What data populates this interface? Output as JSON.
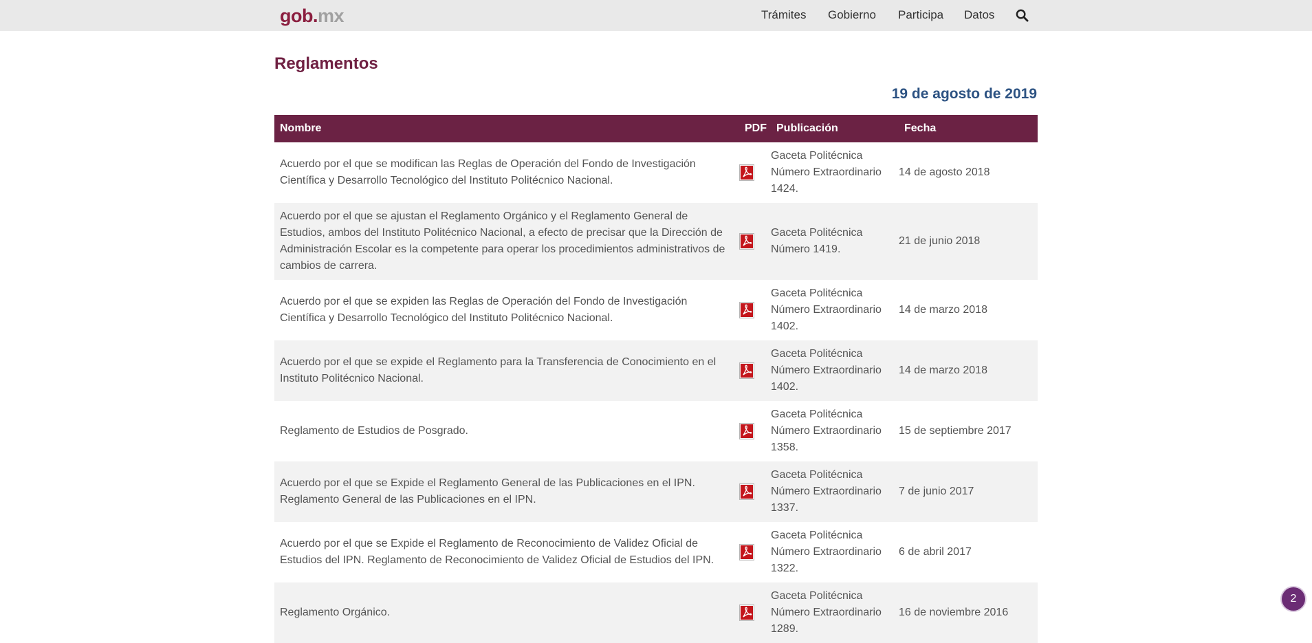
{
  "header": {
    "logo_gob": "gob",
    "logo_dot": ".",
    "logo_mx": "mx",
    "nav": [
      "Trámites",
      "Gobierno",
      "Participa",
      "Datos"
    ],
    "search_icon": "search-icon"
  },
  "page": {
    "title": "Reglamentos",
    "date": "19 de agosto de 2019"
  },
  "table": {
    "headers": {
      "name": "Nombre",
      "pdf": "PDF",
      "pub": "Publicación",
      "date": "Fecha"
    },
    "rows": [
      {
        "name": "Acuerdo por el que se modifican las Reglas de Operación del Fondo de Investigación Científica y Desarrollo Tecnológico del Instituto Politécnico Nacional.",
        "pub": "Gaceta Politécnica Número Extraordinario 1424.",
        "date": "14 de agosto 2018"
      },
      {
        "name": "Acuerdo por el que se ajustan el Reglamento Orgánico y el Reglamento General de Estudios, ambos del Instituto Politécnico Nacional, a efecto de precisar que la Dirección de Administración Escolar es la competente para operar los procedimientos administrativos de cambios de carrera.",
        "pub": "Gaceta Politécnica Número 1419.",
        "date": "21 de junio 2018"
      },
      {
        "name": "Acuerdo por el que se expiden las Reglas de Operación del Fondo de Investigación Científica y Desarrollo Tecnológico del Instituto Politécnico Nacional.",
        "pub": "Gaceta Politécnica Número Extraordinario 1402.",
        "date": "14 de marzo 2018"
      },
      {
        "name": "Acuerdo por el que se expide el Reglamento para la Transferencia de Conocimiento en el Instituto Politécnico Nacional.",
        "pub": "Gaceta Politécnica Número Extraordinario 1402.",
        "date": "14 de marzo 2018"
      },
      {
        "name": "Reglamento de Estudios de Posgrado.",
        "pub": "Gaceta Politécnica Número Extraordinario 1358.",
        "date": "15 de septiembre 2017"
      },
      {
        "name": "Acuerdo por el que se Expide el Reglamento General de las Publicaciones en el IPN. Reglamento General de las Publicaciones en el IPN.",
        "pub": "Gaceta Politécnica Número Extraordinario 1337.",
        "date": "7 de junio 2017"
      },
      {
        "name": "Acuerdo por el que se Expide el Reglamento de Reconocimiento de Validez Oficial de Estudios del IPN. Reglamento de Reconocimiento de Validez Oficial de Estudios del IPN.",
        "pub": "Gaceta Politécnica Número Extraordinario 1322.",
        "date": "6 de abril 2017"
      },
      {
        "name": "Reglamento Orgánico.",
        "pub": "Gaceta Politécnica Número Extraordinario 1289.",
        "date": "16 de noviembre 2016"
      }
    ]
  },
  "help": {
    "label": "2"
  },
  "colors": {
    "brand": "#6b2244",
    "date_heading": "#2c5282",
    "pdf_red": "#c4161c"
  }
}
